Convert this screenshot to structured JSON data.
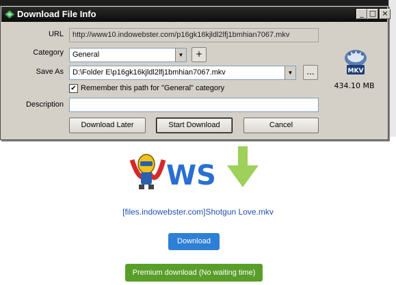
{
  "dialog": {
    "title": "Download File Info",
    "window_controls": {
      "minimize": "_",
      "maximize": "□",
      "close": "×"
    },
    "url_label": "URL",
    "url_value": "http://www10.indowebster.com/p16gk16kjldl2lfj1bmhian7067.mkv",
    "category_label": "Category",
    "category_value": "General",
    "add_category_label": "+",
    "save_as_label": "Save As",
    "save_as_value": "D:\\Folder E\\p16gk16kjldl2lfj1bmhian7067.mkv",
    "browse_label": "...",
    "remember_checked": true,
    "remember_label": "Remember this path for \"General\" category",
    "description_label": "Description",
    "description_value": "",
    "buttons": {
      "download_later": "Download Later",
      "start_download": "Start Download",
      "cancel": "Cancel"
    },
    "file_icon": "mkv-file-icon",
    "file_type_badge": "MKV",
    "file_size": "434.10  MB"
  },
  "page": {
    "logo_text": "WS",
    "logo_icon": "indowebster-mascot-logo",
    "arrow_icon": "green-download-arrow-icon",
    "filename_link": "[files.indowebster.com]Shotgun Love.mkv",
    "download_button": "Download",
    "premium_button": "Premium download (No waiting time)"
  },
  "colors": {
    "titlebar": "#0c0c0c",
    "dialog_bg": "#d4d0c8",
    "link": "#2050b0",
    "download_button": "#2e7fd6",
    "premium_button": "#5a9e2a"
  }
}
